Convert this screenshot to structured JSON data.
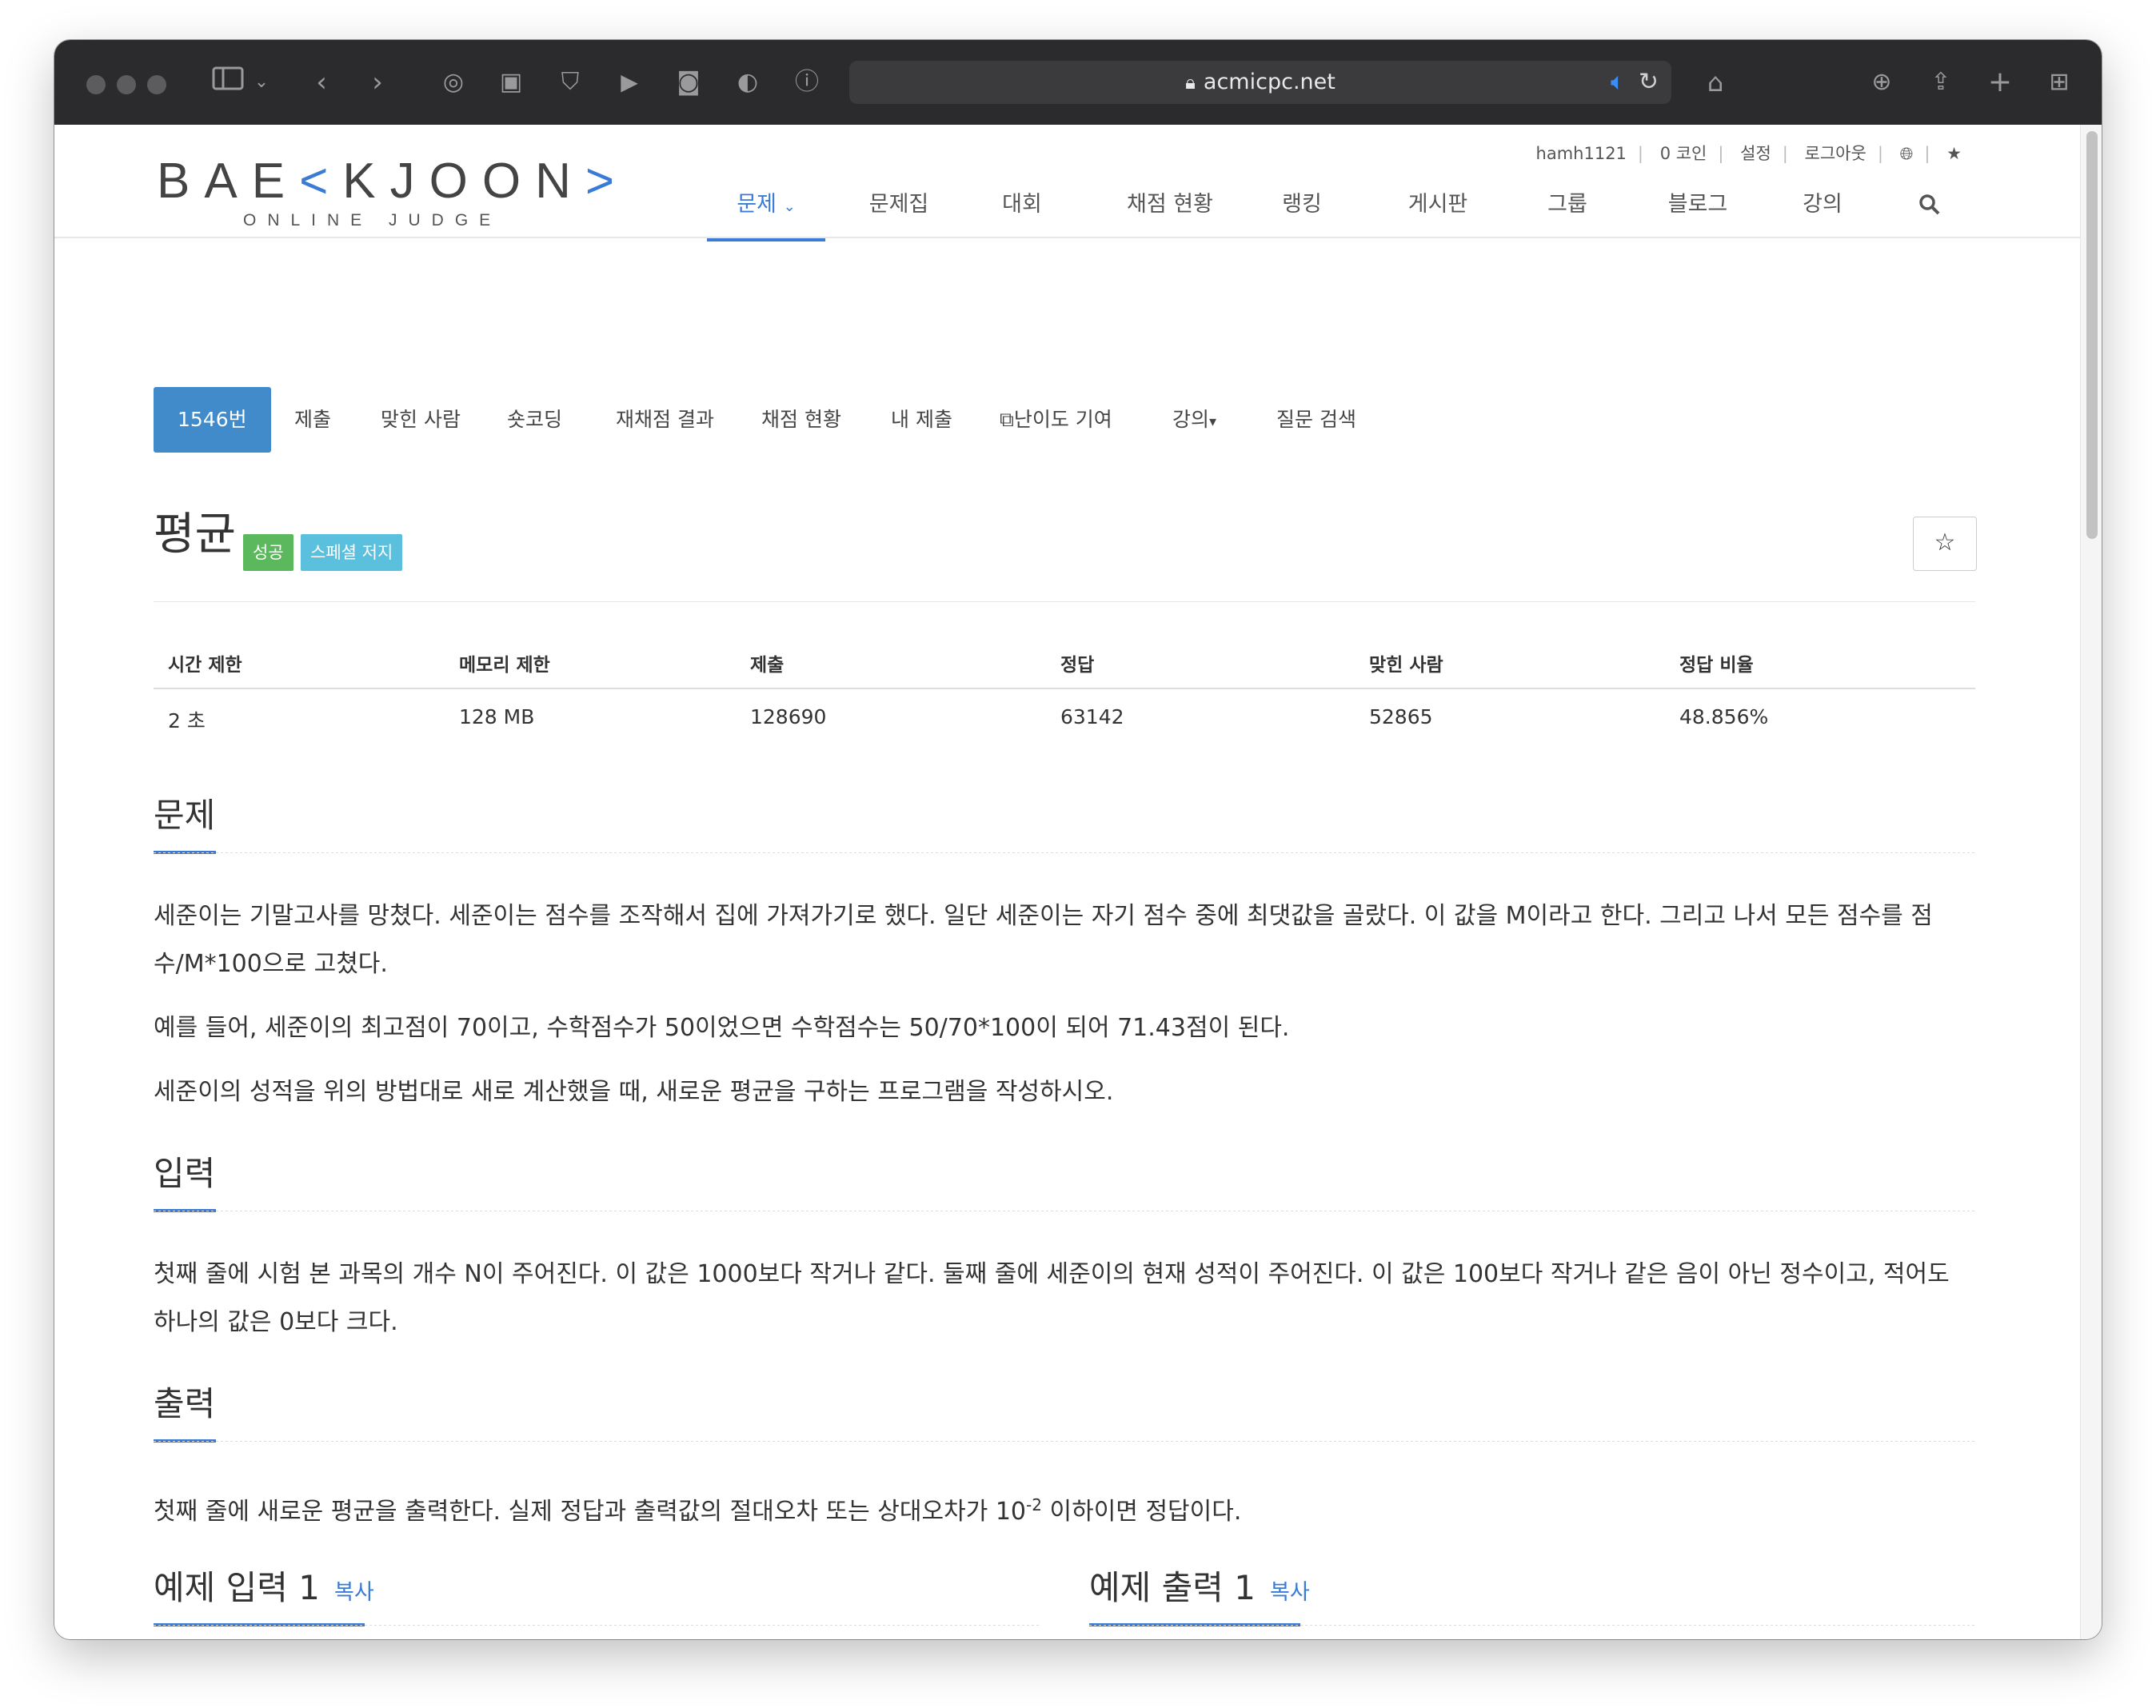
{
  "browser": {
    "url": "acmicpc.net"
  },
  "site": {
    "logo_main_left": "BAE",
    "logo_main_mark": "K",
    "logo_main_right": "JOON",
    "logo_sub": "ONLINE JUDGE",
    "user_links": [
      "hamh1121",
      "0 코인",
      "설정",
      "로그아웃"
    ],
    "nav": [
      "문제",
      "문제집",
      "대회",
      "채점 현황",
      "랭킹",
      "게시판",
      "그룹",
      "블로그",
      "강의"
    ]
  },
  "problem_menu": {
    "active": "1546번",
    "items": [
      "제출",
      "맞힌 사람",
      "숏코딩",
      "재채점 결과",
      "채점 현황",
      "내 제출",
      "난이도 기여",
      "강의",
      "질문 검색"
    ]
  },
  "problem": {
    "title": "평균",
    "label_success": "성공",
    "label_special": "스페셜 저지",
    "star": "☆"
  },
  "stats": {
    "headers": [
      "시간 제한",
      "메모리 제한",
      "제출",
      "정답",
      "맞힌 사람",
      "정답 비율"
    ],
    "values": [
      "2 초",
      "128 MB",
      "128690",
      "63142",
      "52865",
      "48.856%"
    ]
  },
  "sections": {
    "description_title": "문제",
    "description": [
      "세준이는 기말고사를 망쳤다. 세준이는 점수를 조작해서 집에 가져가기로 했다. 일단 세준이는 자기 점수 중에 최댓값을 골랐다. 이 값을 M이라고 한다. 그리고 나서 모든 점수를 점수/M*100으로 고쳤다.",
      "예를 들어, 세준이의 최고점이 70이고, 수학점수가 50이었으면 수학점수는 50/70*100이 되어 71.43점이 된다.",
      "세준이의 성적을 위의 방법대로 새로 계산했을 때, 새로운 평균을 구하는 프로그램을 작성하시오."
    ],
    "input_title": "입력",
    "input": "첫째 줄에 시험 본 과목의 개수 N이 주어진다. 이 값은 1000보다 작거나 같다. 둘째 줄에 세준이의 현재 성적이 주어진다. 이 값은 100보다 작거나 같은 음이 아닌 정수이고, 적어도 하나의 값은 0보다 크다.",
    "output_title": "출력",
    "output_pre": "첫째 줄에 새로운 평균을 출력한다. 실제 정답과 출력값의 절대오차 또는 상대오차가 10",
    "output_sup": "-2",
    "output_post": " 이하이면 정답이다."
  },
  "examples": {
    "input_title": "예제 입력 1",
    "output_title": "예제 출력 1",
    "copy": "복사"
  }
}
